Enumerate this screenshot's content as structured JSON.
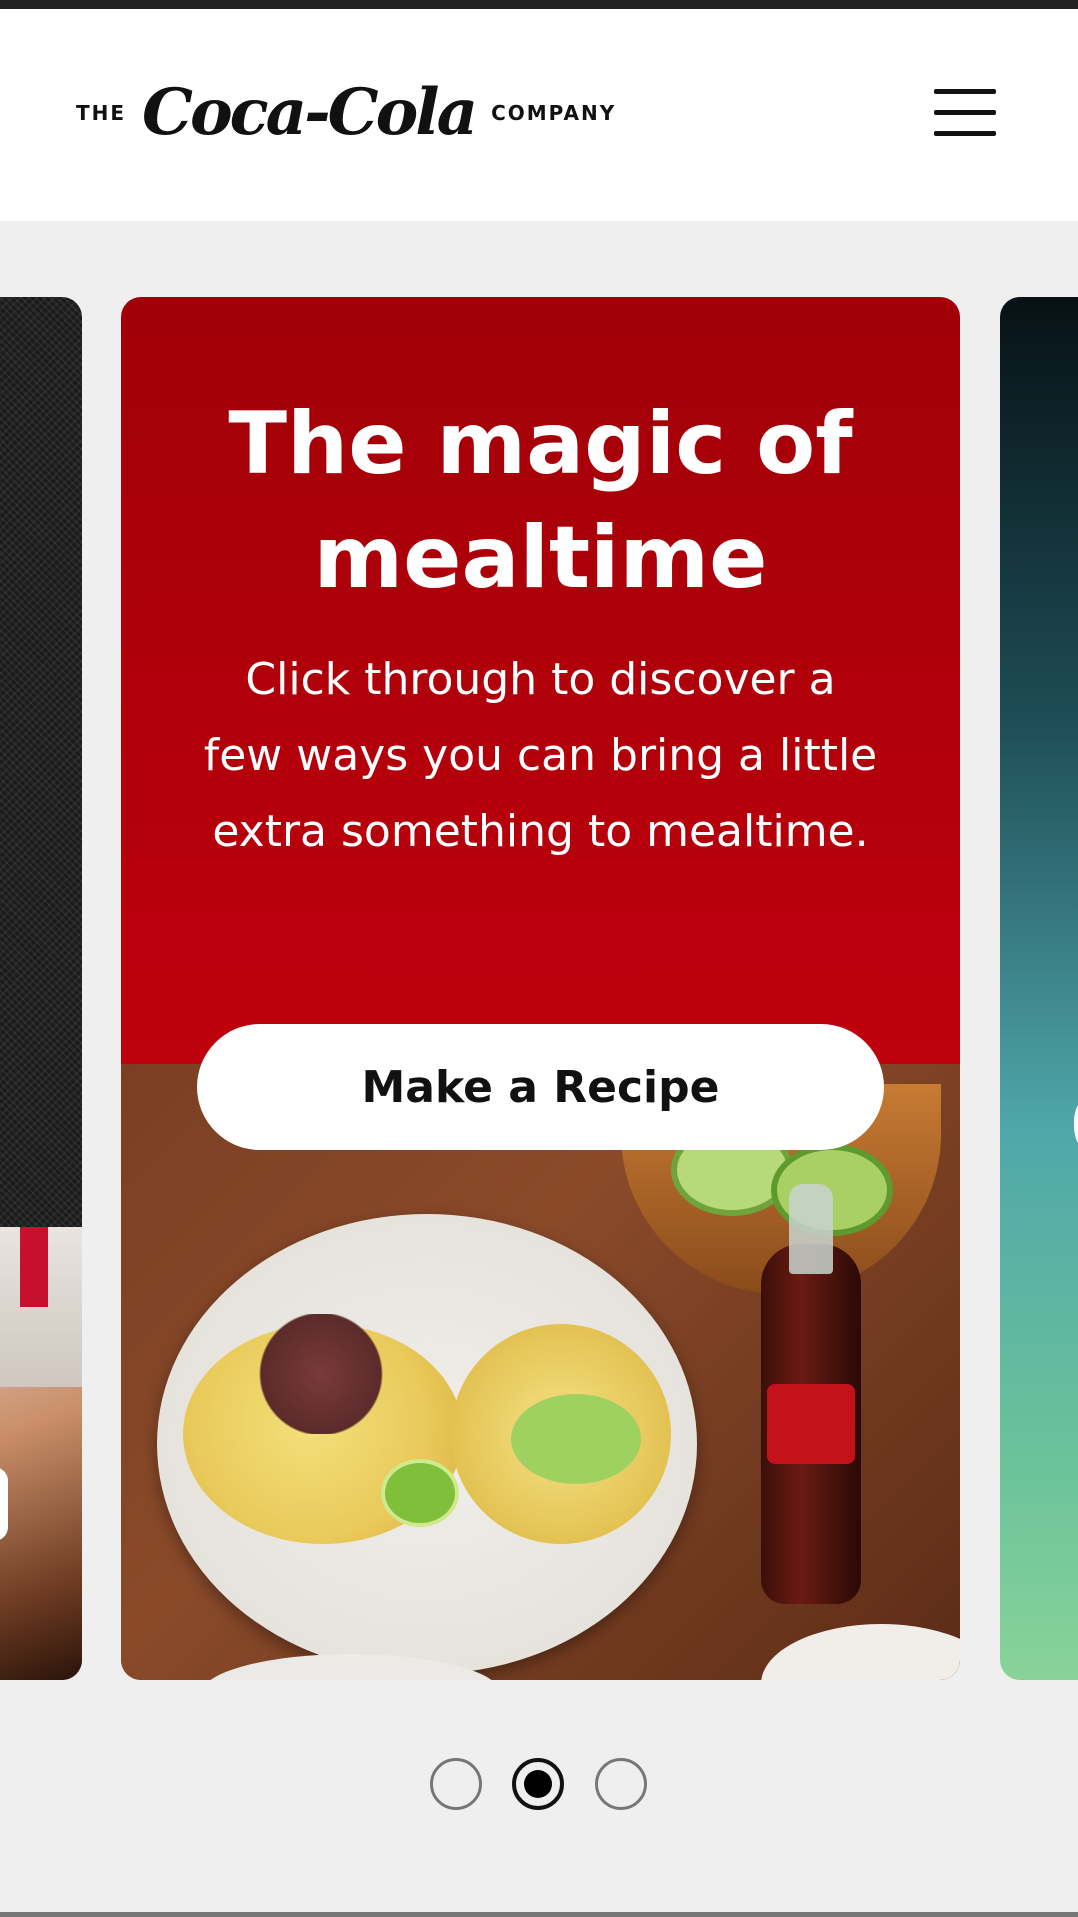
{
  "header": {
    "logo": {
      "prefix": "THE",
      "brand": "Coca-Cola",
      "suffix": "COMPANY"
    },
    "menu_icon": "hamburger-menu-icon"
  },
  "carousel": {
    "active_index": 1,
    "total_slides": 3,
    "current_card": {
      "title": "The magic of mealtime",
      "description": "Click through to discover a few ways you can bring a little extra something to mealtime.",
      "cta_label": "Make a Recipe",
      "background_color": "#b9000c"
    }
  },
  "colors": {
    "brand_red": "#c8102e",
    "page_background": "#efefef",
    "header_background": "#ffffff"
  }
}
